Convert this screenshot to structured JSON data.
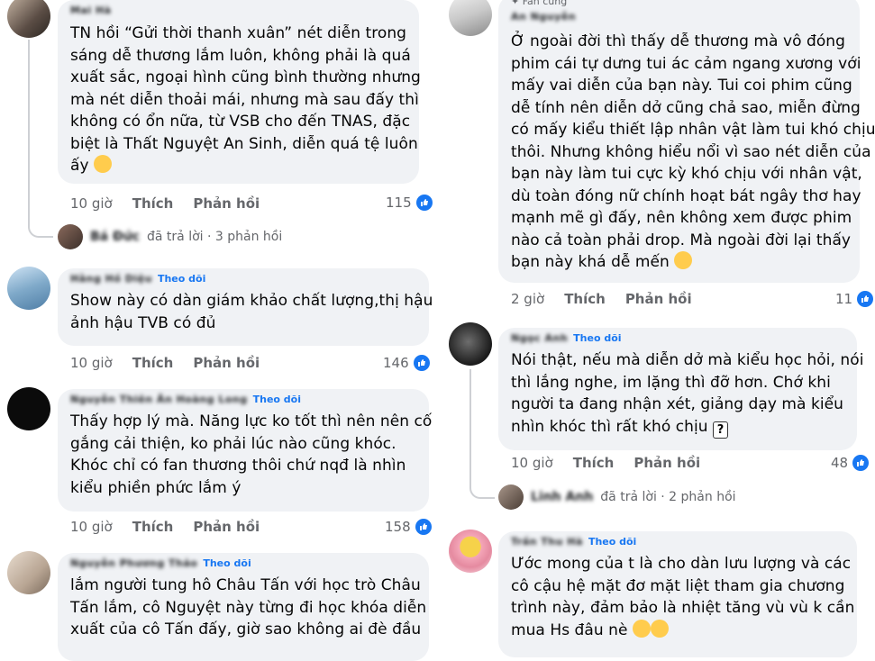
{
  "left_column": {
    "c1": {
      "author": "Mai Hà",
      "lines": [
        "TN hồi “Gửi thời thanh xuân” nét diễn trong",
        "sáng dễ thương lắm luôn, không phải là quá",
        "xuất sắc, ngoại hình cũng bình thường nhưng",
        "mà nét diễn thoải mái, nhưng mà sau đấy thì",
        "không có ổn nữa, từ VSB cho đến TNAS, đặc",
        "biệt là Thất Nguyệt An Sinh, diễn quá tệ luôn",
        "ấy"
      ],
      "time": "10 giờ",
      "like": "Thích",
      "reply": "Phản hồi",
      "count": "115",
      "replies": {
        "name": "Bá Đức",
        "text": "đã trả lời · 3 phản hồi"
      }
    },
    "c2": {
      "author": "Hằng Hồ Diệu",
      "follow": "Theo dõi",
      "lines": [
        "Show này có dàn giám khảo chất lượng,thị hậu",
        "ảnh hậu TVB có đủ"
      ],
      "time": "10 giờ",
      "like": "Thích",
      "reply": "Phản hồi",
      "count": "146"
    },
    "c3": {
      "author": "Nguyễn Thiên Ân Hoàng Long",
      "follow": "Theo dõi",
      "lines": [
        "Thấy hợp lý mà. Năng lực ko tốt thì nên nên cố",
        "gắng cải thiện, ko phải lúc nào cũng khóc.",
        "Khóc chỉ có fan thương thôi chứ nqđ là nhìn",
        "kiểu phiền phức lắm ý"
      ],
      "time": "10 giờ",
      "like": "Thích",
      "reply": "Phản hồi",
      "count": "158"
    },
    "c4": {
      "author": "Nguyễn Phương Thảo",
      "follow": "Theo dõi",
      "lines": [
        "lắm người tung hô Châu Tấn với học trò Châu",
        "Tấn lắm, cô Nguyệt này từng đi học khóa diễn",
        "xuất của cô Tấn đấy, giờ sao không ai đè đầu"
      ]
    }
  },
  "right_column": {
    "c1": {
      "badge": "Fan cứng",
      "author": "An Nguyễn",
      "lines": [
        "Ở ngoài đời thì thấy dễ thương mà vô đóng",
        "phim cái tự dưng tui ác cảm ngang xương với",
        "mấy vai diễn của bạn này. Tui coi phim cũng",
        "dễ tính nên diễn dở cũng chả sao, miễn đừng",
        "có mấy kiểu thiết lập nhân vật làm tui khó chịu",
        "thôi. Nhưng không hiểu nổi vì sao nét diễn của",
        "bạn này làm tui cực kỳ khó chịu với nhân vật,",
        "dù toàn đóng nữ chính hoạt bát ngây thơ hay",
        "mạnh mẽ gì đấy, nên không xem được phim",
        "nào cả toàn phải drop. Mà ngoài đời lại thấy",
        "bạn này khá dễ mến"
      ],
      "time": "2 giờ",
      "like": "Thích",
      "reply": "Phản hồi",
      "count": "11"
    },
    "c2": {
      "author": "Ngọc Anh",
      "follow": "Theo dõi",
      "lines": [
        "Nói thật, nếu mà diễn dở mà kiểu học hỏi, nói",
        "thì lắng nghe, im lặng thì đỡ hơn. Chớ khi",
        "người ta đang nhận xét, giảng dạy mà kiểu",
        "nhìn khóc thì rất khó chịu"
      ],
      "time": "10 giờ",
      "like": "Thích",
      "reply": "Phản hồi",
      "count": "48",
      "replies": {
        "name": "Linh Anh",
        "text": "đã trả lời · 2 phản hồi"
      }
    },
    "c3": {
      "author": "Trần Thu Hà",
      "follow": "Theo dõi",
      "lines": [
        "Ước mong của t là cho dàn lưu lượng và các",
        "cô cậu hệ mặt đơ mặt liệt tham gia chương",
        "trình này, đảm bảo là nhiệt tăng vù vù k cần",
        "mua Hs đâu nè"
      ]
    }
  },
  "colors": {
    "bubble": "#f0f2f5",
    "link": "#1877f2",
    "meta": "#65676b"
  },
  "icons": [
    "like-icon",
    "emoji-icon",
    "question-box-icon"
  ]
}
